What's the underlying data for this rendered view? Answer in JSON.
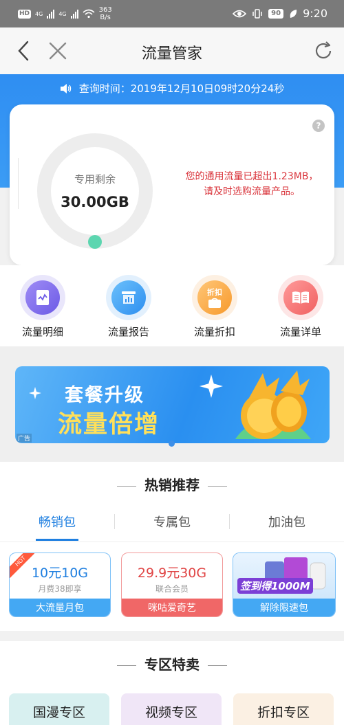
{
  "status_bar": {
    "net_speed_value": "363",
    "net_speed_unit": "B/s",
    "battery": "90",
    "time": "9:20",
    "hd_label": "HD",
    "signal_1": "4G",
    "signal_2": "4G"
  },
  "app_bar": {
    "title": "流量管家"
  },
  "query": {
    "text": "查询时间：2019年12月10日09时20分24秒"
  },
  "usage_card": {
    "label": "专用剩余",
    "value": "30.00GB",
    "remaining_fraction": 1.0,
    "warning_line1": "您的通用流量已超出1.23MB，",
    "warning_line2": "请及时选购流量产品。",
    "help": "?"
  },
  "quick_entries": [
    {
      "label": "流量明细",
      "icon": "document-chart-icon"
    },
    {
      "label": "流量报告",
      "icon": "bar-chart-icon"
    },
    {
      "label": "流量折扣",
      "icon": "discount-bag-icon",
      "badge": "折扣"
    },
    {
      "label": "流量详单",
      "icon": "open-book-icon"
    }
  ],
  "banner": {
    "line1": "套餐升级",
    "line2": "流量倍增",
    "ad_label": "广告"
  },
  "hot": {
    "title": "热销推荐",
    "tabs": [
      "畅销包",
      "专属包",
      "加油包"
    ],
    "active_tab": 0,
    "packages": [
      {
        "name": "10元10G",
        "sub": "月费38即享",
        "foot": "大流量月包",
        "badge": "HOT"
      },
      {
        "name": "29.9元30G",
        "sub": "联合会员",
        "foot": "咪咕爱奇艺"
      },
      {
        "promo": "签到得1000M",
        "foot": "解除限速包"
      }
    ]
  },
  "zone": {
    "title": "专区特卖",
    "cards": [
      "国漫专区",
      "视频专区",
      "折扣专区"
    ]
  },
  "colors": {
    "accent": "#1f7fe0",
    "header_blue": "#2f8ef2",
    "warning_red": "#d9333a",
    "progress_green": "#5cd6b0"
  }
}
